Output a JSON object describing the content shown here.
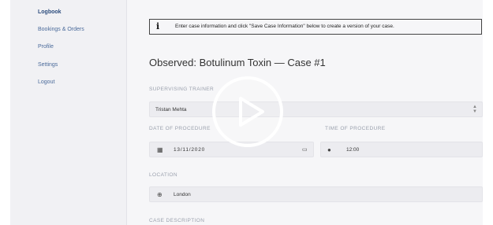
{
  "sidebar": {
    "items": [
      {
        "label": "Logbook",
        "active": true
      },
      {
        "label": "Bookings & Orders",
        "active": false
      },
      {
        "label": "Profile",
        "active": false
      },
      {
        "label": "Settings",
        "active": false
      },
      {
        "label": "Logout",
        "active": false
      }
    ]
  },
  "info": {
    "icon": "info-icon",
    "text": "Enter case information and click \"Save Case Information\" below to create a version of your case."
  },
  "page": {
    "title": "Observed: Botulinum Toxin — Case #1"
  },
  "form": {
    "supervising_trainer": {
      "label": "SUPERVISING TRAINER",
      "value": "Tristan Mehta"
    },
    "date_of_procedure": {
      "label": "DATE OF PROCEDURE",
      "value": "13/11/2020"
    },
    "time_of_procedure": {
      "label": "TIME OF PROCEDURE",
      "value": "12:00"
    },
    "location": {
      "label": "LOCATION",
      "value": "London"
    },
    "case_description": {
      "label": "CASE DESCRIPTION"
    }
  },
  "video": {
    "play_icon": "play-icon"
  },
  "colors": {
    "link": "#4a6a9a",
    "background": "#f6f6f8",
    "field": "#ececf0"
  }
}
